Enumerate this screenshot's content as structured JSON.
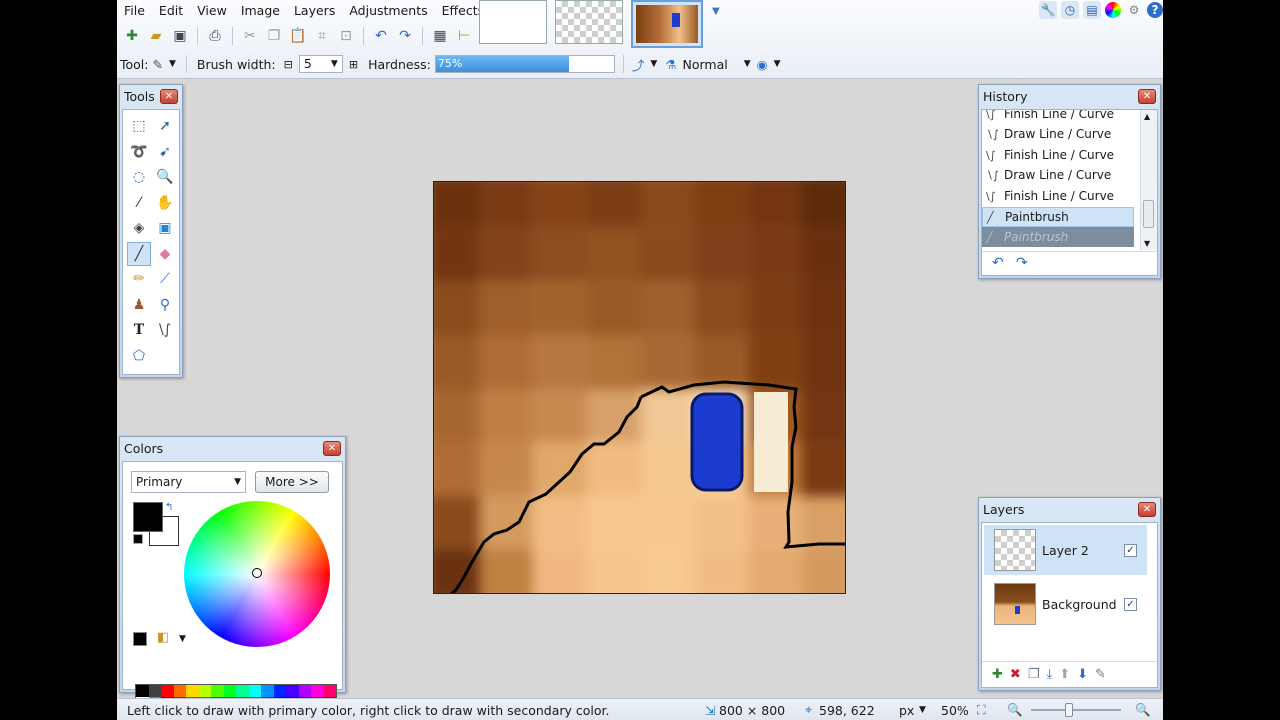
{
  "menu": [
    "File",
    "Edit",
    "View",
    "Image",
    "Layers",
    "Adjustments",
    "Effects"
  ],
  "toolbar": {
    "tool_label": "Tool:",
    "brush_width_label": "Brush width:",
    "brush_width_value": "5",
    "hardness_label": "Hardness:",
    "hardness_value": "75%",
    "hardness_fraction": 0.75,
    "blend_mode": "Normal"
  },
  "tools_panel": {
    "title": "Tools"
  },
  "history_panel": {
    "title": "History",
    "items": [
      {
        "label": "Finish Line / Curve",
        "icon": "curve-icon"
      },
      {
        "label": "Draw Line / Curve",
        "icon": "curve-icon"
      },
      {
        "label": "Finish Line / Curve",
        "icon": "curve-icon"
      },
      {
        "label": "Draw Line / Curve",
        "icon": "curve-icon"
      },
      {
        "label": "Finish Line / Curve",
        "icon": "curve-icon"
      },
      {
        "label": "Paintbrush",
        "icon": "paintbrush-icon",
        "state": "selected"
      },
      {
        "label": "Paintbrush",
        "icon": "paintbrush-icon",
        "state": "undone"
      }
    ]
  },
  "colors_panel": {
    "title": "Colors",
    "mode_select": "Primary",
    "more_button": "More >>",
    "primary_color": "#000000",
    "secondary_color": "#ffffff"
  },
  "layers_panel": {
    "title": "Layers",
    "layers": [
      {
        "name": "Layer 2",
        "visible": true,
        "selected": true
      },
      {
        "name": "Background",
        "visible": true,
        "selected": false
      }
    ]
  },
  "status": {
    "hint": "Left click to draw with primary color, right click to draw with secondary color.",
    "image_size": "800 × 800",
    "cursor_pos": "598, 622",
    "unit": "px",
    "zoom": "50%"
  },
  "colors": {
    "accent": "#3a8fe0",
    "selection": "#cfe3f7",
    "workspace": "#d7d7d7"
  }
}
